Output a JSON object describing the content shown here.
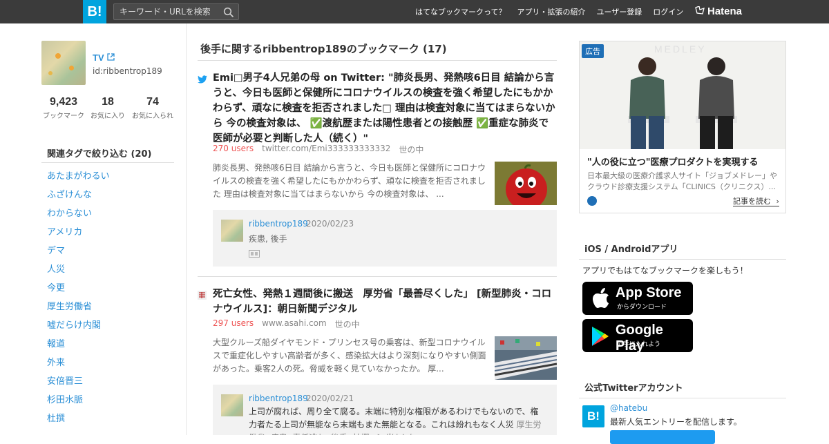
{
  "header": {
    "logo": "B!",
    "search_placeholder": "キーワード・URLを検索",
    "nav": [
      "はてなブックマークって？",
      "アプリ・拡張の紹介",
      "ユーザー登録",
      "ログイン"
    ],
    "brand": "Hatena"
  },
  "profile": {
    "name": "TV",
    "id": "id:ribbentrop189",
    "stats": [
      {
        "value": "9,423",
        "label": "ブックマーク"
      },
      {
        "value": "18",
        "label": "お気に入り"
      },
      {
        "value": "74",
        "label": "お気に入られ"
      }
    ]
  },
  "tags": {
    "heading": "関連タグで絞り込む (20)",
    "items": [
      "あたまがわるい",
      "ふざけんな",
      "わからない",
      "アメリカ",
      "デマ",
      "人災",
      "今更",
      "厚生労働省",
      "嘘だらけ内閣",
      "報道",
      "外来",
      "安倍晋三",
      "杉田水脈",
      "杜撰"
    ]
  },
  "main": {
    "title": "後手に関するribbentrop189のブックマーク (17)",
    "entries": [
      {
        "title": "Emi□男子4人兄弟の母 on Twitter: \"肺炎長男、発熱咳6日目 結論から言うと、今日も医師と保健所にコロナウイルスの検査を強く希望したにもかかわらず、頑なに検査を拒否されました□ 理由は検査対象に当てはまらないから 今の検査対象は、 ✅渡航歴または陽性患者との接触歴 ✅重症な肺炎で医師が必要と判断した人（続く）\"",
        "users": "270 users",
        "domain": "twitter.com/Emi333333333332",
        "category": "世の中",
        "description": "肺炎長男、発熱咳6日目 結論から言うと、今日も医師と保健所にコロナウイルスの検査を強く希望したにもかかわらず、頑なに検査を拒否されました 理由は検査対象に当てはまらないから 今の検査対象は、 ...",
        "comment_user": "ribbentrop189",
        "comment_date": "2020/02/23",
        "comment_tags": "疾患, 後手"
      },
      {
        "title": "死亡女性、発熱１週間後に搬送　厚労省「最善尽くした」 [新型肺炎・コロナウイルス]：朝日新聞デジタル",
        "users": "297 users",
        "domain": "www.asahi.com",
        "category": "世の中",
        "description": "大型クルーズ船ダイヤモンド・プリンセス号の乗客は、新型コロナウイルスで重症化しやすい高齢者が多く、感染拡大はより深刻になりやすい側面があった。乗客2人の死。脅威を軽く見ていなかったか。 厚...",
        "comment_user": "ribbentrop189",
        "comment_date": "2020/02/21",
        "comment_text": "上司が腐れば、周り全て腐る。末端に特別な権限があるわけでもないので、権力者たる上司が無能なら末端もまた無能となる。これは紛れもなく人災",
        "comment_tags": "厚生労働省, 疾患, 責任逃れ, 後手, 杜撰, ふざけんな"
      }
    ]
  },
  "sidebar": {
    "ad_badge": "広告",
    "ad_watermark": "MEDLEY",
    "ad_title": "\"人の役に立つ\"医療プロダクトを実現する",
    "ad_desc": "日本最大級の医療介護求人サイト「ジョブメドレー」やクラウド診療支援システム「CLINICS（クリニクス）...",
    "ad_more": "記事を読む",
    "apps_heading": "iOS / Androidアプリ",
    "apps_desc": "アプリでもはてなブックマークを楽しもう！",
    "appstore_big": "App Store",
    "appstore_small": "からダウンロード",
    "googleplay_big": "Google Play",
    "googleplay_small": "で手に入れよう",
    "twitter_heading": "公式Twitterアカウント",
    "twitter_logo": "B!",
    "twitter_handle": "@hatebu",
    "twitter_desc": "最新人気エントリーを配信します。"
  },
  "colors": {
    "accent": "#00a4de",
    "link": "#2b8fd6",
    "users": "#ee5555",
    "topbar": "#3b3b3b"
  }
}
